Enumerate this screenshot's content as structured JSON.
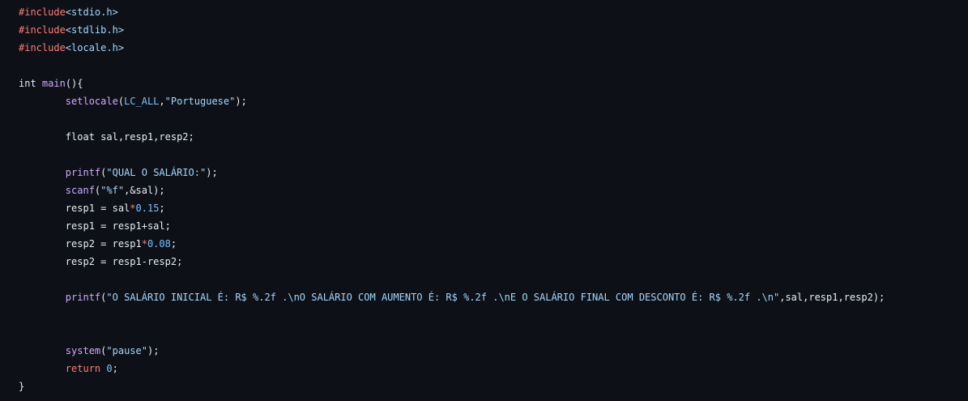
{
  "colors": {
    "background": "#0d1117",
    "plain": "#e6edf3",
    "keyword": "#ff7b72",
    "function": "#d2a8ff",
    "string": "#a5d6ff",
    "number": "#79c0ff",
    "constant": "#79c0ff",
    "operator": "#ff7b72"
  },
  "code": {
    "lines": [
      [
        {
          "t": "#include",
          "k": "keyword"
        },
        {
          "t": "<stdio.h>",
          "k": "string"
        }
      ],
      [
        {
          "t": "#include",
          "k": "keyword"
        },
        {
          "t": "<stdlib.h>",
          "k": "string"
        }
      ],
      [
        {
          "t": "#include",
          "k": "keyword"
        },
        {
          "t": "<locale.h>",
          "k": "string"
        }
      ],
      [],
      [
        {
          "t": "int ",
          "k": "plain"
        },
        {
          "t": "main",
          "k": "function"
        },
        {
          "t": "(){",
          "k": "plain"
        }
      ],
      [
        {
          "t": "        ",
          "k": "plain"
        },
        {
          "t": "setlocale",
          "k": "function"
        },
        {
          "t": "(",
          "k": "plain"
        },
        {
          "t": "LC_ALL",
          "k": "constant"
        },
        {
          "t": ",",
          "k": "plain"
        },
        {
          "t": "\"Portuguese\"",
          "k": "string"
        },
        {
          "t": ");",
          "k": "plain"
        }
      ],
      [],
      [
        {
          "t": "        float sal,resp1,resp2;",
          "k": "plain"
        }
      ],
      [],
      [
        {
          "t": "        ",
          "k": "plain"
        },
        {
          "t": "printf",
          "k": "function"
        },
        {
          "t": "(",
          "k": "plain"
        },
        {
          "t": "\"QUAL O SALÁRIO:\"",
          "k": "string"
        },
        {
          "t": ");",
          "k": "plain"
        }
      ],
      [
        {
          "t": "        ",
          "k": "plain"
        },
        {
          "t": "scanf",
          "k": "function"
        },
        {
          "t": "(",
          "k": "plain"
        },
        {
          "t": "\"%f\"",
          "k": "string"
        },
        {
          "t": ",&sal);",
          "k": "plain"
        }
      ],
      [
        {
          "t": "        resp1 = sal",
          "k": "plain"
        },
        {
          "t": "*",
          "k": "operator"
        },
        {
          "t": "0.15",
          "k": "number"
        },
        {
          "t": ";",
          "k": "plain"
        }
      ],
      [
        {
          "t": "        resp1 = resp1+sal;",
          "k": "plain"
        }
      ],
      [
        {
          "t": "        resp2 = resp1",
          "k": "plain"
        },
        {
          "t": "*",
          "k": "operator"
        },
        {
          "t": "0.08",
          "k": "number"
        },
        {
          "t": ";",
          "k": "plain"
        }
      ],
      [
        {
          "t": "        resp2 = resp1-resp2;",
          "k": "plain"
        }
      ],
      [],
      [
        {
          "t": "        ",
          "k": "plain"
        },
        {
          "t": "printf",
          "k": "function"
        },
        {
          "t": "(",
          "k": "plain"
        },
        {
          "t": "\"O SALÁRIO INICIAL É: R$ %.2f .\\nO SALÁRIO COM AUMENTO É: R$ %.2f .\\nE O SALÁRIO FINAL COM DESCONTO É: R$ %.2f .\\n\"",
          "k": "string"
        },
        {
          "t": ",sal,resp1,resp2);",
          "k": "plain"
        }
      ],
      [],
      [],
      [
        {
          "t": "        ",
          "k": "plain"
        },
        {
          "t": "system",
          "k": "function"
        },
        {
          "t": "(",
          "k": "plain"
        },
        {
          "t": "\"pause\"",
          "k": "string"
        },
        {
          "t": ");",
          "k": "plain"
        }
      ],
      [
        {
          "t": "        ",
          "k": "plain"
        },
        {
          "t": "return",
          "k": "keyword"
        },
        {
          "t": " ",
          "k": "plain"
        },
        {
          "t": "0",
          "k": "number"
        },
        {
          "t": ";",
          "k": "plain"
        }
      ],
      [
        {
          "t": "}",
          "k": "plain"
        }
      ]
    ]
  }
}
